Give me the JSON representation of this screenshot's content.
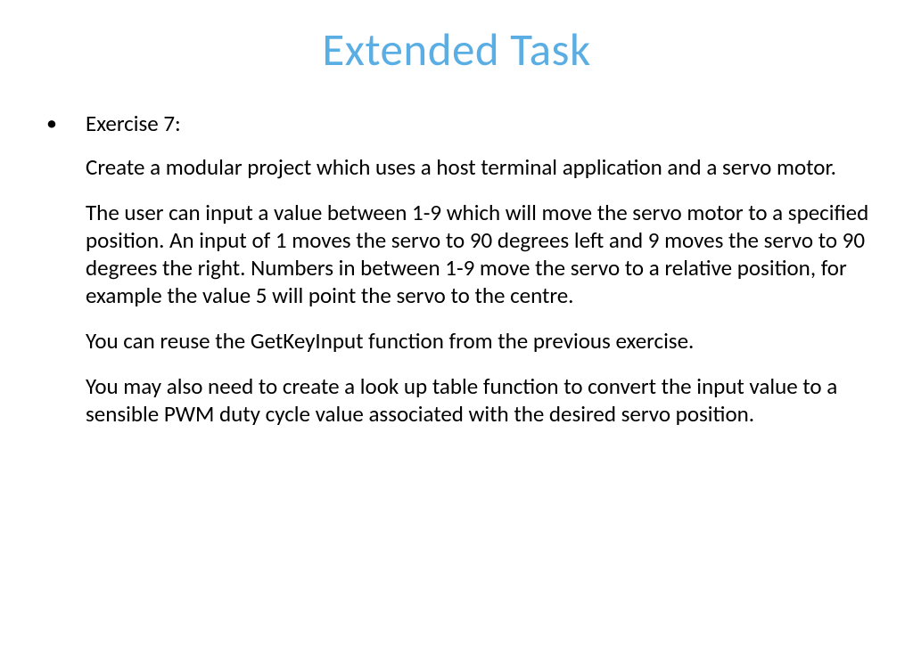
{
  "title": "Extended Task",
  "exercise_label": "Exercise 7:",
  "paragraphs": {
    "p1": "Create a modular project which uses a host terminal application and a servo motor.",
    "p2": "The user can input a value between 1-9 which will move the servo motor to a specified position. An input of 1 moves the servo to 90 degrees left and 9 moves the servo to 90 degrees the right. Numbers in between 1-9 move the servo to a relative position, for example the value 5 will point the servo to the centre.",
    "p3": "You can reuse the GetKeyInput function from the previous exercise.",
    "p4": "You may also need to create a look up table function to convert the input value to a sensible PWM duty cycle value associated with the desired servo position."
  }
}
